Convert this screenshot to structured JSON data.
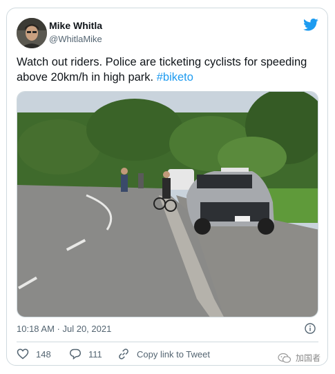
{
  "author": {
    "name": "Mike Whitla",
    "handle": "@WhitlaMike"
  },
  "tweet": {
    "text_main": "Watch out riders. Police are ticketing cyclists for speeding above 20km/h in high park. ",
    "hashtag": "#biketo",
    "timestamp": "10:18 AM · Jul 20, 2021"
  },
  "actions": {
    "likes": "148",
    "replies": "111",
    "copy_link_label": "Copy link to Tweet"
  },
  "watermark": {
    "label": "加国者"
  },
  "colors": {
    "link": "#1d9bf0",
    "secondary_text": "#536471",
    "border": "#cfd9de"
  },
  "icons": [
    "twitter-bird-icon",
    "info-icon",
    "heart-icon",
    "reply-icon",
    "link-icon",
    "wechat-icon"
  ]
}
